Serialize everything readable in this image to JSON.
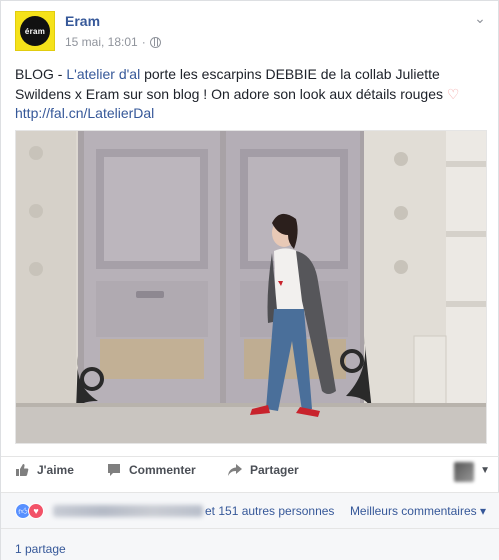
{
  "post": {
    "page_name": "Eram",
    "avatar_text": "éram",
    "timestamp": "15 mai, 18:01",
    "separator": "·",
    "text": {
      "prefix": "BLOG - ",
      "mention": "L'atelier d'al",
      "body": " porte les escarpins DEBBIE de la collab Juliette Swildens x Eram sur son blog ! On adore son look aux détails rouges ",
      "heart": "♡",
      "link": "http://fal.cn/LatelierDal"
    }
  },
  "actions": {
    "like": "J'aime",
    "comment": "Commenter",
    "share": "Partager"
  },
  "reactions": {
    "others": "et 151 autres personnes",
    "top_comments": "Meilleurs commentaires ▾"
  },
  "shares": "1 partage",
  "colors": {
    "link": "#365899",
    "avatar_bg": "#f5e21a",
    "like_blue": "#5890ff",
    "love_red": "#f25268",
    "shoe_red": "#c8232c"
  },
  "icons": [
    "globe-icon",
    "chevron-down-icon",
    "like-icon",
    "comment-icon",
    "share-icon",
    "like-reaction-icon",
    "love-reaction-icon"
  ]
}
